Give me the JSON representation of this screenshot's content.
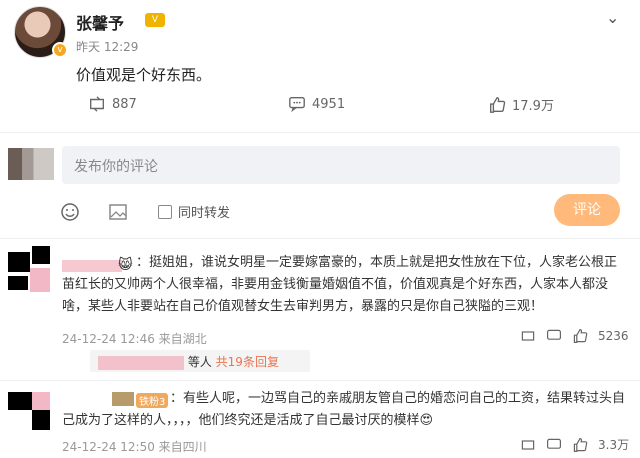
{
  "post": {
    "author": "张馨予",
    "level": "V",
    "time": "昨天 12:29",
    "text": "价值观是个好东西。",
    "reposts": "887",
    "comments": "4951",
    "likes": "17.9万"
  },
  "compose": {
    "placeholder": "发布你的评论",
    "also_repost": "同时转发",
    "submit": "评论"
  },
  "comments": [
    {
      "text_line1": "：挺姐姐，谁说女明星一定要嫁富豪的，本质上就是把女性放在下位，人家老公根正",
      "text_line2": "苗红长的又帅两个人很幸福，非要用金钱衡量婚姻值不值，价值观真是个好东西，人家本人都没",
      "text_line3": "啥，某些人非要站在自己价值观替女生去审判男方，暴露的只是你自己狭隘的三观！",
      "time": "24-12-24 12:46 来自湖北",
      "likes": "5236",
      "reply_suffix": "等人",
      "reply_count": "共19条回复"
    },
    {
      "badge": "铁粉3",
      "text_line1": "：有些人呢，一边骂自己的亲戚朋友管自己的婚恋问自己的工资，结果转过头自",
      "text_line2": "己成为了这样的人，，，，他们终究还是活成了自己最讨厌的模样😍",
      "time": "24-12-24 12:50 来自四川",
      "likes": "3.3万"
    }
  ],
  "colors": {
    "accent": "#eb7350",
    "submit_bg": "#ffb97a",
    "badge": "#f0b400"
  }
}
